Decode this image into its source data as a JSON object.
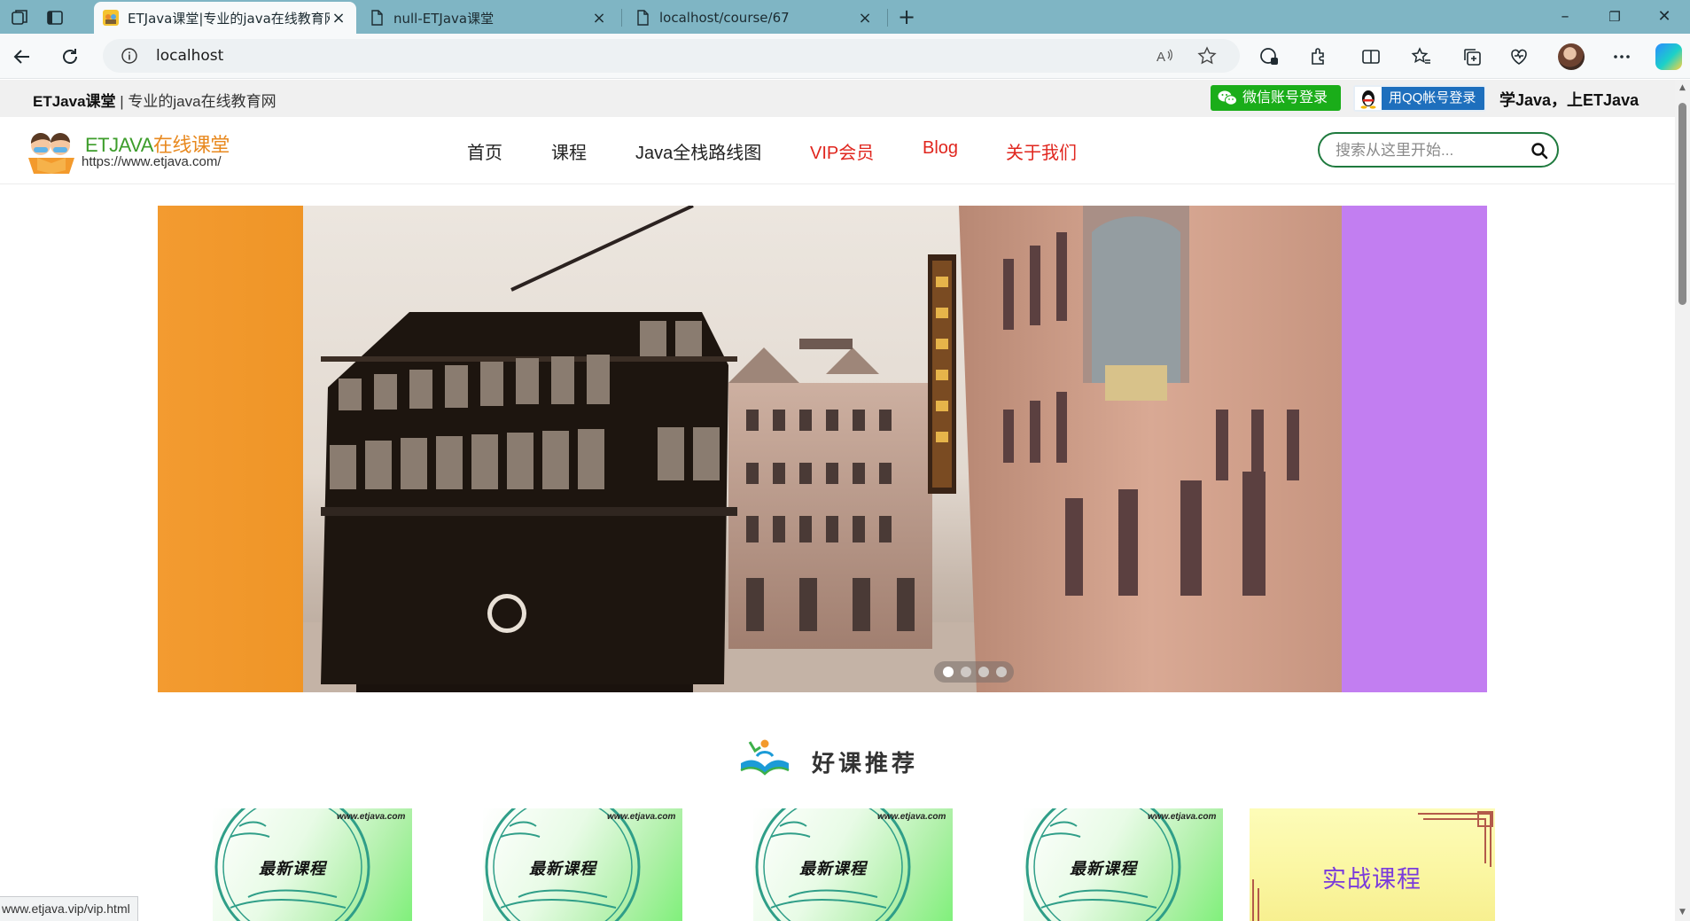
{
  "browser": {
    "tabs": [
      {
        "title": "ETJava课堂|专业的java在线教育网",
        "active": true
      },
      {
        "title": "null-ETJava课堂",
        "active": false
      },
      {
        "title": "localhost/course/67",
        "active": false
      }
    ],
    "new_tab_symbol": "+",
    "url": "localhost",
    "status_url": "www.etjava.vip/vip.html"
  },
  "site": {
    "topstrip": {
      "brand_name": "ETJava课堂",
      "brand_tagline": " | 专业的java在线教育网",
      "wechat_login": "微信账号登录",
      "qq_login": "用QQ帐号登录",
      "slogan": "学Java，上ETJava"
    },
    "logo": {
      "name_latin": "ETJAVA",
      "name_cn": "在线课堂",
      "url": "https://www.etjava.com/"
    },
    "menu": [
      {
        "label": "首页",
        "color": "#222222"
      },
      {
        "label": "课程",
        "color": "#222222"
      },
      {
        "label": "Java全栈路线图",
        "color": "#222222"
      },
      {
        "label": "VIP会员",
        "color": "#e0261e"
      },
      {
        "label": "Blog",
        "color": "#e0261e"
      },
      {
        "label": "关于我们",
        "color": "#e0261e"
      }
    ],
    "search": {
      "placeholder": "搜索从这里开始..."
    },
    "carousel": {
      "slide_count": 4,
      "active_index": 0,
      "left_color": "#f39b30",
      "right_color": "#c27ef1"
    },
    "section_title": "好课推荐",
    "cards": [
      {
        "site": "www.etjava.com",
        "label": "最新课程"
      },
      {
        "site": "www.etjava.com",
        "label": "最新课程"
      },
      {
        "site": "www.etjava.com",
        "label": "最新课程"
      },
      {
        "site": "www.etjava.com",
        "label": "最新课程"
      }
    ],
    "feature_card": {
      "label": "实战课程"
    }
  }
}
